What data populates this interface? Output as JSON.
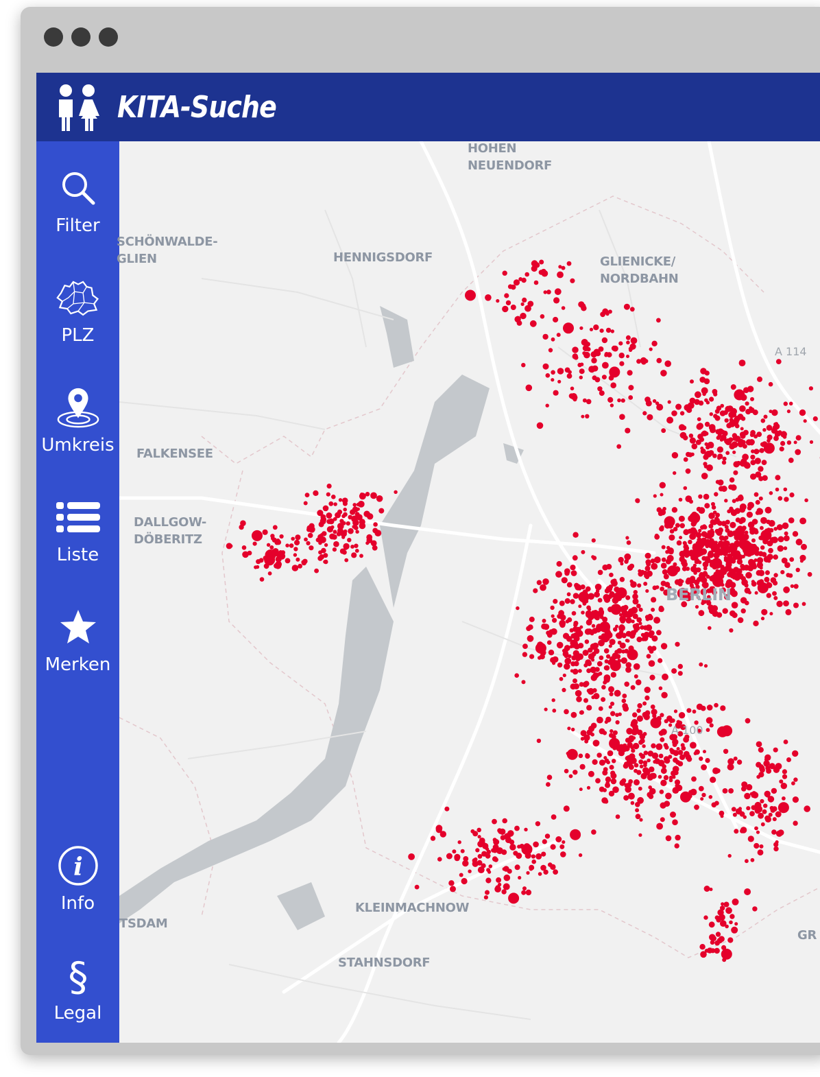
{
  "app": {
    "title": "KITA-Suche",
    "logo_icon": "parents-icon",
    "colors": {
      "header": "#1d3390",
      "sidebar": "#334fcf",
      "marker": "#e4002b",
      "water": "#c4c8cc"
    }
  },
  "sidebar": {
    "items": [
      {
        "label": "Filter",
        "icon": "search-icon"
      },
      {
        "label": "PLZ",
        "icon": "berlin-districts-icon"
      },
      {
        "label": "Umkreis",
        "icon": "radius-pin-icon"
      },
      {
        "label": "Liste",
        "icon": "list-icon"
      },
      {
        "label": "Merken",
        "icon": "star-icon"
      },
      {
        "label": "Info",
        "icon": "info-icon"
      },
      {
        "label": "Legal",
        "icon": "paragraph-icon"
      }
    ]
  },
  "map": {
    "places": [
      "HOHEN\nNEUENDORF",
      "SCHÖNWALDE-\nGLIEN",
      "HENNIGSDORF",
      "GLIENICKE/\nNORDBAHN",
      "FALKENSEE",
      "DALLGOW-\nDÖBERITZ",
      "BERLIN",
      "KLEINMACHNOW",
      "STAHNSDORF",
      "TSDAM",
      "GR"
    ],
    "roads": [
      "A 114",
      "A 100"
    ],
    "marker_type": "kita-location-marker"
  }
}
